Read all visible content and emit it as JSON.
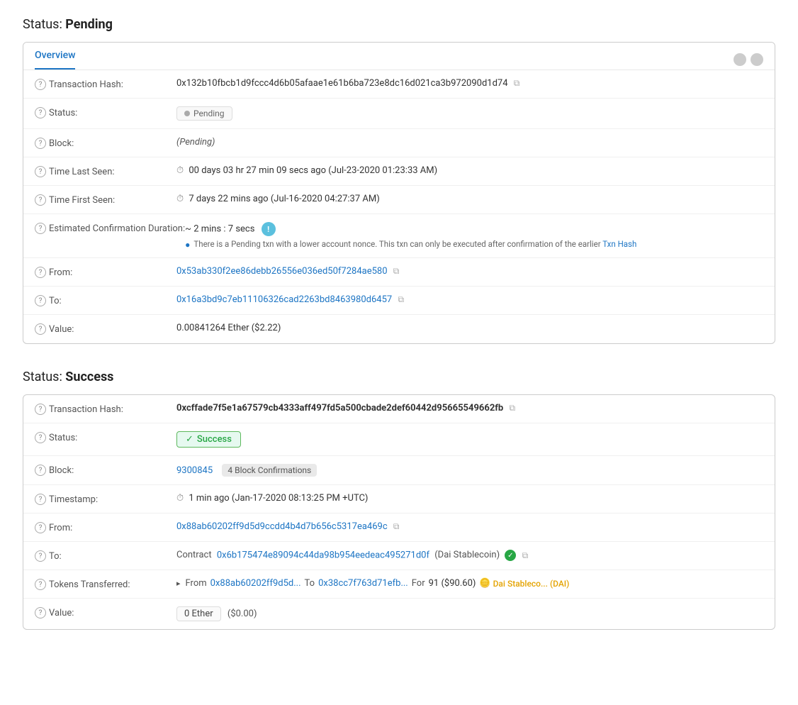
{
  "pending_section": {
    "title": "Status: ",
    "title_bold": "Pending",
    "tab": {
      "label": "Overview",
      "icons": [
        "circle1",
        "circle2"
      ]
    },
    "rows": {
      "transaction_hash": {
        "label": "Transaction Hash:",
        "value": "0x132b10fbcb1d9fccc4d6b05afaae1e61b6ba723e8dc16d021ca3b972090d1d74"
      },
      "status": {
        "label": "Status:",
        "badge": "Pending"
      },
      "block": {
        "label": "Block:",
        "value": "(Pending)"
      },
      "time_last_seen": {
        "label": "Time Last Seen:",
        "value": "00 days 03 hr 27 min 09 secs ago (Jul-23-2020 01:23:33 AM)"
      },
      "time_first_seen": {
        "label": "Time First Seen:",
        "value": "7 days 22 mins ago (Jul-16-2020 04:27:37 AM)"
      },
      "estimated_confirmation": {
        "label": "Estimated Confirmation Duration:",
        "value": "~ 2 mins : 7 secs",
        "note": "There is a Pending txn with a lower account nonce. This txn can only be executed after confirmation of the earlier Txn Hash"
      },
      "from": {
        "label": "From:",
        "value": "0x53ab330f2ee86debb26556e036ed50f7284ae580"
      },
      "to": {
        "label": "To:",
        "value": "0x16a3bd9c7eb11106326cad2263bd8463980d6457"
      },
      "value": {
        "label": "Value:",
        "value": "0.00841264 Ether ($2.22)"
      }
    }
  },
  "success_section": {
    "title": "Status: ",
    "title_bold": "Success",
    "rows": {
      "transaction_hash": {
        "label": "Transaction Hash:",
        "value": "0xcffade7f5e1a67579cb4333aff497fd5a500cbade2def60442d95665549662fb"
      },
      "status": {
        "label": "Status:",
        "badge": "Success"
      },
      "block": {
        "label": "Block:",
        "block_number": "9300845",
        "confirmations": "4 Block Confirmations"
      },
      "timestamp": {
        "label": "Timestamp:",
        "value": "1 min ago (Jan-17-2020 08:13:25 PM +UTC)"
      },
      "from": {
        "label": "From:",
        "value": "0x88ab60202ff9d5d9ccdd4b4d7b656c5317ea469c"
      },
      "to": {
        "label": "To:",
        "contract_label": "Contract",
        "contract_address": "0x6b175474e89094c44da98b954eedeac495271d0f",
        "contract_name": "(Dai Stablecoin)"
      },
      "tokens_transferred": {
        "label": "Tokens Transferred:",
        "from_label": "From",
        "from_address": "0x88ab60202ff9d5d...",
        "to_label": "To",
        "to_address": "0x38cc7f763d71efb...",
        "for_label": "For",
        "amount": "91 ($90.60)",
        "token_name": "Dai Stableco... (DAI)"
      },
      "value": {
        "label": "Value:",
        "box": "0 Ether",
        "usd": "($0.00)"
      }
    }
  },
  "icons": {
    "question": "?",
    "copy": "⧉",
    "clock": "⏱",
    "check": "✓",
    "info": "●",
    "arrow": "▸"
  }
}
